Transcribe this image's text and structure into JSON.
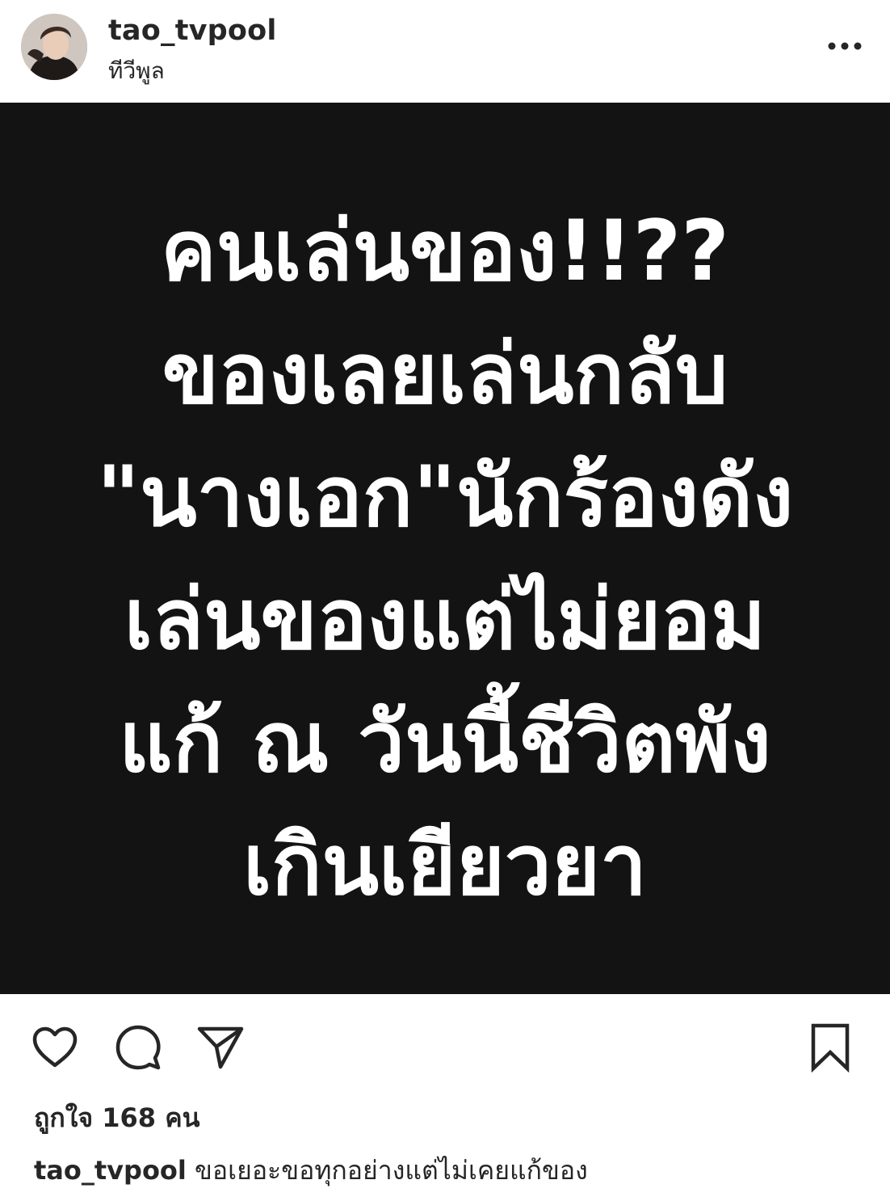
{
  "post_header": {
    "username": "tao_tvpool",
    "location": "ทีวีพูล"
  },
  "post_image": {
    "lines": [
      "คนเล่นของ!!??",
      "ของเลยเล่นกลับ",
      "\"นางเอก\"นักร้องดัง",
      "เล่นของแต่ไม่ยอม",
      "แก้ ณ วันนี้ชีวิตพัง",
      "เกินเยียวยา"
    ]
  },
  "actions": {
    "like_icon": "heart-icon",
    "comment_icon": "comment-icon",
    "share_icon": "send-icon",
    "save_icon": "bookmark-icon"
  },
  "likes_text": "ถูกใจ 168 คน",
  "caption": {
    "username": "tao_tvpool",
    "text": "ขอเยอะขอทุกอย่างแต่ไม่เคยแก้ของ"
  },
  "colors": {
    "image_background": "#131313",
    "text": "#262626"
  }
}
